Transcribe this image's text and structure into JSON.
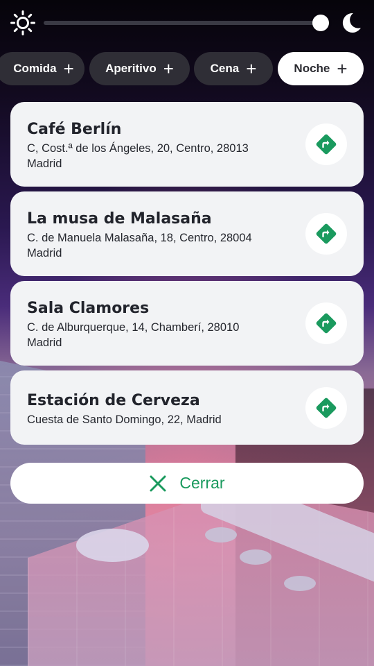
{
  "theme": {
    "slider_value_percent": 100,
    "sun_icon": "sun-icon",
    "moon_icon": "moon-icon"
  },
  "filters": [
    {
      "label": "Comida",
      "active": false
    },
    {
      "label": "Aperitivo",
      "active": false
    },
    {
      "label": "Cena",
      "active": false
    },
    {
      "label": "Noche",
      "active": true
    }
  ],
  "places": [
    {
      "name": "Café Berlín",
      "address_line1": "C, Cost.ª de los Ángeles, 20, Centro, 28013",
      "address_line2": "Madrid"
    },
    {
      "name": "La musa de Malasaña",
      "address_line1": "C. de Manuela Malasaña, 18, Centro, 28004",
      "address_line2": "Madrid"
    },
    {
      "name": "Sala Clamores",
      "address_line1": "C. de Alburquerque, 14, Chamberí, 28010",
      "address_line2": "Madrid"
    },
    {
      "name": "Estación de Cerveza",
      "address_line1": "Cuesta de Santo Domingo, 22, Madrid",
      "address_line2": ""
    }
  ],
  "close_button": {
    "label": "Cerrar",
    "icon": "close-icon"
  },
  "colors": {
    "accent_green": "#1a9a5e",
    "chip_dark": "#2f2e36",
    "card_bg": "#f2f3f5"
  }
}
